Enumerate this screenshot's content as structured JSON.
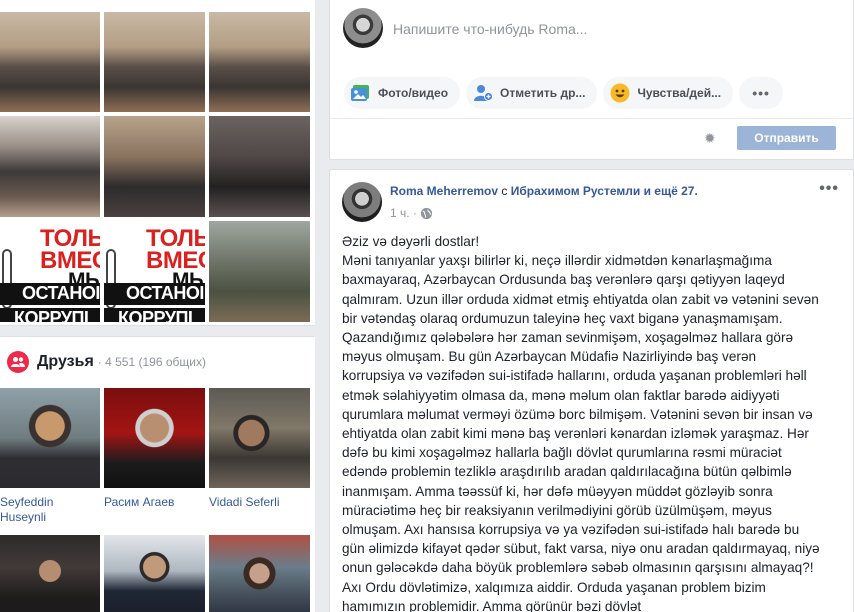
{
  "photos": {
    "poster_text": {
      "line1": "ТОЛЬ",
      "line2": "ВМЕС",
      "line3": "МЫ",
      "line4": "ОСТАНОІ",
      "line5": "КОРРУПІ"
    }
  },
  "friends": {
    "title": "Друзья",
    "count": "· 4 551 (196 общих)",
    "items": [
      {
        "name": "Seyfeddin Huseynli"
      },
      {
        "name": "Расим Агаев"
      },
      {
        "name": "Vidadi Seferli"
      },
      {
        "name": ""
      },
      {
        "name": ""
      },
      {
        "name": ""
      }
    ]
  },
  "composer": {
    "placeholder": "Напишите что-нибудь Roma...",
    "actions": [
      {
        "label": "Фото/видео",
        "icon": "photo-icon"
      },
      {
        "label": "Отметить др...",
        "icon": "tag-friends-icon"
      },
      {
        "label": "Чувства/дей...",
        "icon": "feeling-icon"
      }
    ],
    "more_label": "•••",
    "send_label": "Отправить"
  },
  "post": {
    "author": "Roma Meherremov",
    "with_text": "с",
    "tagged": "Ибрахимом Рустемли и ещё 27.",
    "time": "1 ч. ·",
    "menu_label": "•••",
    "paragraphs": [
      "Əziz və dəyərli dostlar!",
      "Məni tanıyanlar yaxşı bilirlər ki, neçə illərdir xidmətdən kənarlaşmağıma baxmayaraq, Azərbaycan Ordusunda baş verənlərə qarşı qətiyyən laqeyd qalmıram. Uzun illər orduda xidmət etmiş ehtiyatda olan zabit və vətənini sevən bir vətəndaş olaraq ordumuzun taleyinə heç vaxt biganə yanaşmamışam. Qazandığımız qələbələrə hər zaman sevinmişəm, xoşagəlməz hallara görə məyus olmuşam. Bu gün Azərbaycan Müdafiə Nazirliyində baş verən korrupsiya və vəzifədən sui-istifadə hallarını, orduda yaşanan problemləri həll etmək səlahiyyətim olmasa da, mənə məlum olan faktlar barədə aidiyyəti qurumlara məlumat verməyi özümə borc bilmişəm. Vətənini sevən bir insan və ehtiyatda olan zabit kimi mənə baş verənləri kənardan izləmək yaraşmaz. Hər dəfə bu kimi xoşagəlməz hallarla bağlı dövlət qurumlarına rəsmi müraciət edəndə problemin tezliklə araşdırılıb aradan qaldırılacağına bütün qəlbimlə inanmışam. Amma təəssüf ki, hər dəfə müəyyən müddət gözləyib sonra müraciətimə heç bir reaksiyanın verilmədiyini görüb üzülmüşəm, məyus olmuşam. Axı hansısa korrupsiya və ya vəzifədən sui-istifadə halı barədə bu gün əlimizdə kifayət qədər sübut, fakt varsa, niyə onu aradan qaldırmayaq, niyə onun gələcəkdə daha böyük problemlərə səbəb olmasının qarşısını almayaq?! Axı Ordu dövlətimizə, xalqımıza aiddir. Orduda yaşanan problem bizim hamımızın problemidir. Amma görünür bəzi dövlət"
    ]
  }
}
